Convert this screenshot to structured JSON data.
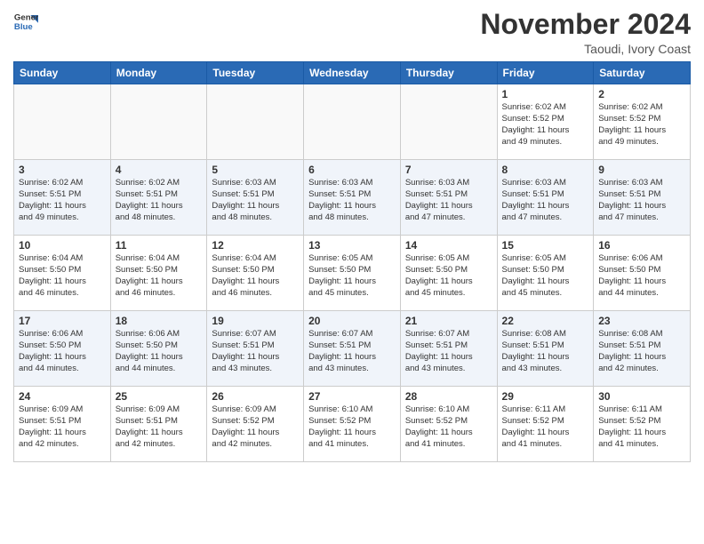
{
  "header": {
    "logo_line1": "General",
    "logo_line2": "Blue",
    "month_title": "November 2024",
    "location": "Taoudi, Ivory Coast"
  },
  "weekdays": [
    "Sunday",
    "Monday",
    "Tuesday",
    "Wednesday",
    "Thursday",
    "Friday",
    "Saturday"
  ],
  "weeks": [
    {
      "row_class": "row-odd",
      "days": [
        {
          "num": "",
          "info": "",
          "empty": true
        },
        {
          "num": "",
          "info": "",
          "empty": true
        },
        {
          "num": "",
          "info": "",
          "empty": true
        },
        {
          "num": "",
          "info": "",
          "empty": true
        },
        {
          "num": "",
          "info": "",
          "empty": true
        },
        {
          "num": "1",
          "info": "Sunrise: 6:02 AM\nSunset: 5:52 PM\nDaylight: 11 hours\nand 49 minutes.",
          "empty": false
        },
        {
          "num": "2",
          "info": "Sunrise: 6:02 AM\nSunset: 5:52 PM\nDaylight: 11 hours\nand 49 minutes.",
          "empty": false
        }
      ]
    },
    {
      "row_class": "row-even",
      "days": [
        {
          "num": "3",
          "info": "Sunrise: 6:02 AM\nSunset: 5:51 PM\nDaylight: 11 hours\nand 49 minutes.",
          "empty": false
        },
        {
          "num": "4",
          "info": "Sunrise: 6:02 AM\nSunset: 5:51 PM\nDaylight: 11 hours\nand 48 minutes.",
          "empty": false
        },
        {
          "num": "5",
          "info": "Sunrise: 6:03 AM\nSunset: 5:51 PM\nDaylight: 11 hours\nand 48 minutes.",
          "empty": false
        },
        {
          "num": "6",
          "info": "Sunrise: 6:03 AM\nSunset: 5:51 PM\nDaylight: 11 hours\nand 48 minutes.",
          "empty": false
        },
        {
          "num": "7",
          "info": "Sunrise: 6:03 AM\nSunset: 5:51 PM\nDaylight: 11 hours\nand 47 minutes.",
          "empty": false
        },
        {
          "num": "8",
          "info": "Sunrise: 6:03 AM\nSunset: 5:51 PM\nDaylight: 11 hours\nand 47 minutes.",
          "empty": false
        },
        {
          "num": "9",
          "info": "Sunrise: 6:03 AM\nSunset: 5:51 PM\nDaylight: 11 hours\nand 47 minutes.",
          "empty": false
        }
      ]
    },
    {
      "row_class": "row-odd",
      "days": [
        {
          "num": "10",
          "info": "Sunrise: 6:04 AM\nSunset: 5:50 PM\nDaylight: 11 hours\nand 46 minutes.",
          "empty": false
        },
        {
          "num": "11",
          "info": "Sunrise: 6:04 AM\nSunset: 5:50 PM\nDaylight: 11 hours\nand 46 minutes.",
          "empty": false
        },
        {
          "num": "12",
          "info": "Sunrise: 6:04 AM\nSunset: 5:50 PM\nDaylight: 11 hours\nand 46 minutes.",
          "empty": false
        },
        {
          "num": "13",
          "info": "Sunrise: 6:05 AM\nSunset: 5:50 PM\nDaylight: 11 hours\nand 45 minutes.",
          "empty": false
        },
        {
          "num": "14",
          "info": "Sunrise: 6:05 AM\nSunset: 5:50 PM\nDaylight: 11 hours\nand 45 minutes.",
          "empty": false
        },
        {
          "num": "15",
          "info": "Sunrise: 6:05 AM\nSunset: 5:50 PM\nDaylight: 11 hours\nand 45 minutes.",
          "empty": false
        },
        {
          "num": "16",
          "info": "Sunrise: 6:06 AM\nSunset: 5:50 PM\nDaylight: 11 hours\nand 44 minutes.",
          "empty": false
        }
      ]
    },
    {
      "row_class": "row-even",
      "days": [
        {
          "num": "17",
          "info": "Sunrise: 6:06 AM\nSunset: 5:50 PM\nDaylight: 11 hours\nand 44 minutes.",
          "empty": false
        },
        {
          "num": "18",
          "info": "Sunrise: 6:06 AM\nSunset: 5:50 PM\nDaylight: 11 hours\nand 44 minutes.",
          "empty": false
        },
        {
          "num": "19",
          "info": "Sunrise: 6:07 AM\nSunset: 5:51 PM\nDaylight: 11 hours\nand 43 minutes.",
          "empty": false
        },
        {
          "num": "20",
          "info": "Sunrise: 6:07 AM\nSunset: 5:51 PM\nDaylight: 11 hours\nand 43 minutes.",
          "empty": false
        },
        {
          "num": "21",
          "info": "Sunrise: 6:07 AM\nSunset: 5:51 PM\nDaylight: 11 hours\nand 43 minutes.",
          "empty": false
        },
        {
          "num": "22",
          "info": "Sunrise: 6:08 AM\nSunset: 5:51 PM\nDaylight: 11 hours\nand 43 minutes.",
          "empty": false
        },
        {
          "num": "23",
          "info": "Sunrise: 6:08 AM\nSunset: 5:51 PM\nDaylight: 11 hours\nand 42 minutes.",
          "empty": false
        }
      ]
    },
    {
      "row_class": "row-odd",
      "days": [
        {
          "num": "24",
          "info": "Sunrise: 6:09 AM\nSunset: 5:51 PM\nDaylight: 11 hours\nand 42 minutes.",
          "empty": false
        },
        {
          "num": "25",
          "info": "Sunrise: 6:09 AM\nSunset: 5:51 PM\nDaylight: 11 hours\nand 42 minutes.",
          "empty": false
        },
        {
          "num": "26",
          "info": "Sunrise: 6:09 AM\nSunset: 5:52 PM\nDaylight: 11 hours\nand 42 minutes.",
          "empty": false
        },
        {
          "num": "27",
          "info": "Sunrise: 6:10 AM\nSunset: 5:52 PM\nDaylight: 11 hours\nand 41 minutes.",
          "empty": false
        },
        {
          "num": "28",
          "info": "Sunrise: 6:10 AM\nSunset: 5:52 PM\nDaylight: 11 hours\nand 41 minutes.",
          "empty": false
        },
        {
          "num": "29",
          "info": "Sunrise: 6:11 AM\nSunset: 5:52 PM\nDaylight: 11 hours\nand 41 minutes.",
          "empty": false
        },
        {
          "num": "30",
          "info": "Sunrise: 6:11 AM\nSunset: 5:52 PM\nDaylight: 11 hours\nand 41 minutes.",
          "empty": false
        }
      ]
    }
  ]
}
